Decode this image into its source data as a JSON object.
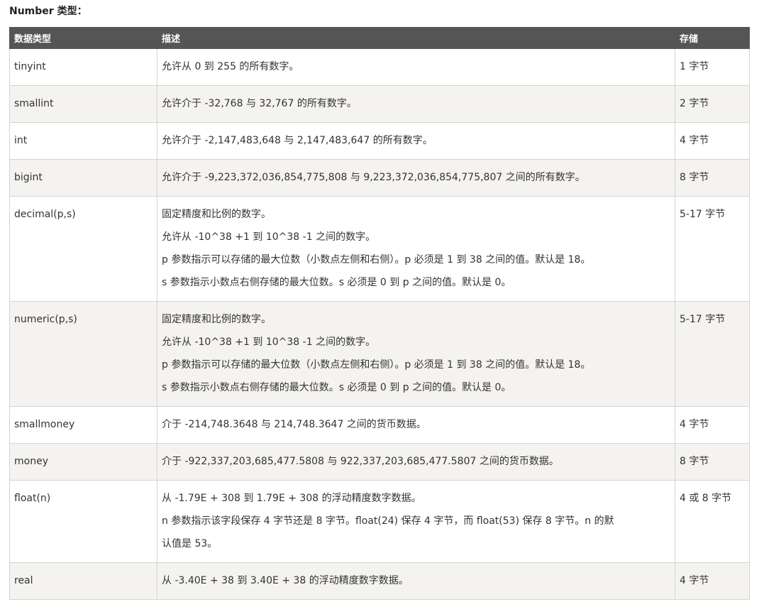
{
  "section_title": "Number 类型：",
  "table": {
    "headers": [
      "数据类型",
      "描述",
      "存储"
    ],
    "rows": [
      {
        "type": "tinyint",
        "desc": [
          "允许从 0 到 255 的所有数字。"
        ],
        "storage": "1 字节"
      },
      {
        "type": "smallint",
        "desc": [
          "允许介于 -32,768 与 32,767 的所有数字。"
        ],
        "storage": "2 字节"
      },
      {
        "type": "int",
        "desc": [
          "允许介于 -2,147,483,648 与 2,147,483,647 的所有数字。"
        ],
        "storage": "4 字节"
      },
      {
        "type": "bigint",
        "desc": [
          "允许介于 -9,223,372,036,854,775,808 与 9,223,372,036,854,775,807 之间的所有数字。"
        ],
        "storage": "8 字节"
      },
      {
        "type": "decimal(p,s)",
        "desc": [
          "固定精度和比例的数字。",
          "允许从 -10^38 +1 到 10^38 -1 之间的数字。",
          "p 参数指示可以存储的最大位数（小数点左侧和右侧）。p 必须是 1 到 38 之间的值。默认是 18。",
          "s 参数指示小数点右侧存储的最大位数。s 必须是 0 到 p 之间的值。默认是 0。"
        ],
        "storage": "5-17 字节"
      },
      {
        "type": "numeric(p,s)",
        "desc": [
          "固定精度和比例的数字。",
          "允许从 -10^38 +1 到 10^38 -1 之间的数字。",
          "p 参数指示可以存储的最大位数（小数点左侧和右侧）。p 必须是 1 到 38 之间的值。默认是 18。",
          "s 参数指示小数点右侧存储的最大位数。s 必须是 0 到 p 之间的值。默认是 0。"
        ],
        "storage": "5-17 字节"
      },
      {
        "type": "smallmoney",
        "desc": [
          "介于 -214,748.3648 与 214,748.3647 之间的货币数据。"
        ],
        "storage": "4 字节"
      },
      {
        "type": "money",
        "desc": [
          "介于 -922,337,203,685,477.5808 与 922,337,203,685,477.5807 之间的货币数据。"
        ],
        "storage": "8 字节"
      },
      {
        "type": "float(n)",
        "desc": [
          "从 -1.79E + 308 到 1.79E + 308 的浮动精度数字数据。",
          "n 参数指示该字段保存 4 字节还是 8 字节。float(24) 保存 4 字节，而 float(53) 保存 8 字节。n 的默",
          "认值是 53。"
        ],
        "storage": "4 或 8 字节"
      },
      {
        "type": "real",
        "desc": [
          "从 -3.40E + 38 到 3.40E + 38 的浮动精度数字数据。"
        ],
        "storage": "4 字节"
      }
    ]
  }
}
